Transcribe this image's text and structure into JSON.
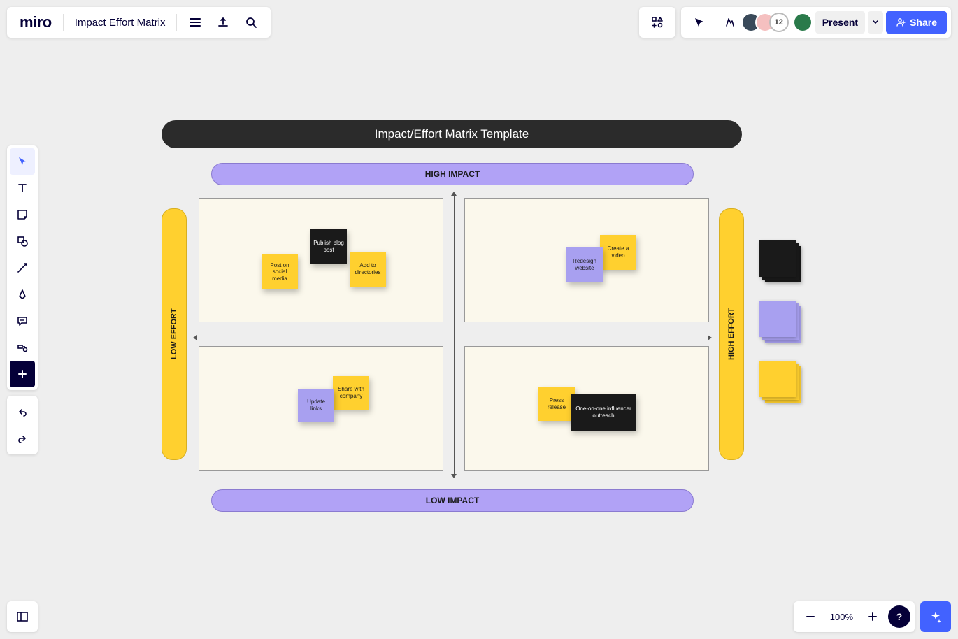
{
  "header": {
    "logo": "miro",
    "board_title": "Impact Effort Matrix",
    "avatar_count": "12",
    "present_label": "Present",
    "share_label": "Share"
  },
  "canvas": {
    "title": "Impact/Effort Matrix Template",
    "axis_top": "HIGH IMPACT",
    "axis_bottom": "LOW IMPACT",
    "axis_left": "LOW EFFORT",
    "axis_right": "HIGH EFFORT",
    "stickies": {
      "q1": [
        {
          "text": "Post on social media",
          "color": "yellow"
        },
        {
          "text": "Publish blog post",
          "color": "black"
        },
        {
          "text": "Add to directories",
          "color": "yellow"
        }
      ],
      "q2": [
        {
          "text": "Redesign website",
          "color": "purple"
        },
        {
          "text": "Create a video",
          "color": "yellow"
        }
      ],
      "q3": [
        {
          "text": "Update links",
          "color": "purple"
        },
        {
          "text": "Share with company",
          "color": "yellow"
        }
      ],
      "q4": [
        {
          "text": "Press release",
          "color": "yellow"
        },
        {
          "text": "One-on-one influencer outreach",
          "color": "black"
        }
      ]
    }
  },
  "footer": {
    "zoom": "100%",
    "help": "?"
  }
}
